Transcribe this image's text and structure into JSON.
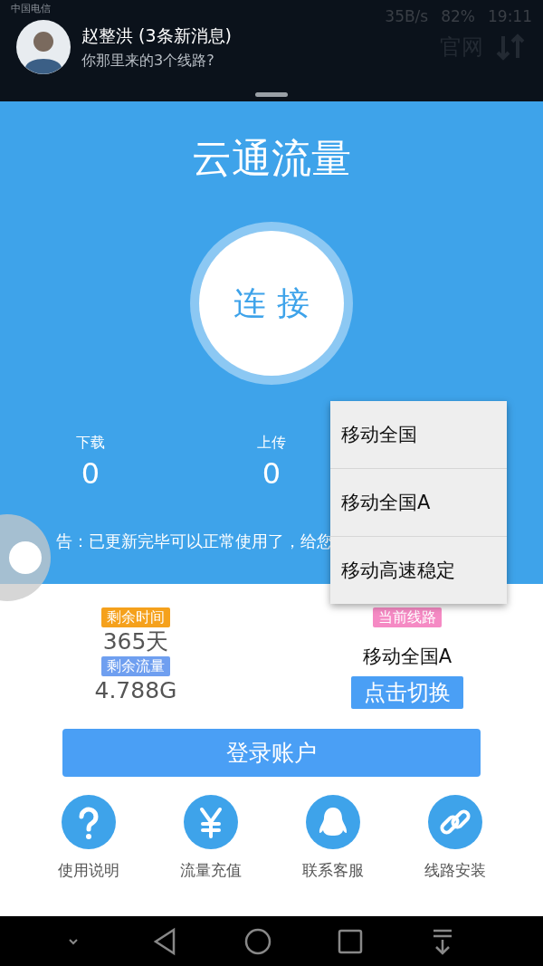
{
  "status_bar": {
    "carrier": "中国电信",
    "speed": "35B/s",
    "battery": "82%",
    "time": "19:11"
  },
  "notification": {
    "title": "赵整洪 (3条新消息)",
    "message": "你那里来的3个线路?"
  },
  "header_action": "官网",
  "app_title": "云通流量",
  "connect_button": "连 接",
  "stats": [
    {
      "label": "下载",
      "value": "0"
    },
    {
      "label": "上传",
      "value": "0"
    }
  ],
  "notice": "告：已更新完毕可以正常使用了，给您",
  "line_menu": [
    "移动全国",
    "移动全国A",
    "移动高速稳定"
  ],
  "remaining": [
    {
      "label": "剩余时间",
      "value": "365天",
      "color": "#f5a11c"
    },
    {
      "label": "剩余流量",
      "value": "4.788G",
      "color": "#6f9ff0"
    }
  ],
  "current_line": {
    "label": "当前线路",
    "value": "移动全国A",
    "switch_button": "点击切换"
  },
  "login_button": "登录账户",
  "shortcuts": [
    {
      "label": "使用说明",
      "kind": "help"
    },
    {
      "label": "流量充值",
      "kind": "yen"
    },
    {
      "label": "联系客服",
      "kind": "penguin"
    },
    {
      "label": "线路安装",
      "kind": "link"
    }
  ]
}
